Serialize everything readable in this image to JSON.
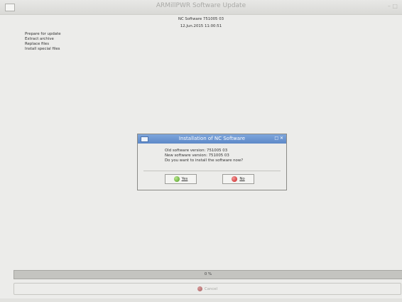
{
  "window": {
    "title": "ARMillPWR Software Update",
    "controls": "– □"
  },
  "header": {
    "line1": "NC Software 751005 03",
    "line2": "12.Jun.2015 11:00:51"
  },
  "steps": [
    "Prepare for update",
    "Extract archive",
    "Replace files",
    "Install special files"
  ],
  "progress": {
    "percent": 0,
    "label": "0 %"
  },
  "cancel": {
    "label": "Cancel",
    "icon": "cancel-icon"
  },
  "dialog": {
    "title": "Installation of NC Software",
    "controls": "□ ✕",
    "old_version": "Old software version: 751005 03",
    "new_version": "New software version: 751005 03",
    "question": "Do you want to install the software now?",
    "yes_label": "Yes",
    "no_label": "No",
    "colors": {
      "title_bg": "#6b93d0",
      "yes_icon": "#5aa82b",
      "no_icon": "#d22222"
    }
  }
}
